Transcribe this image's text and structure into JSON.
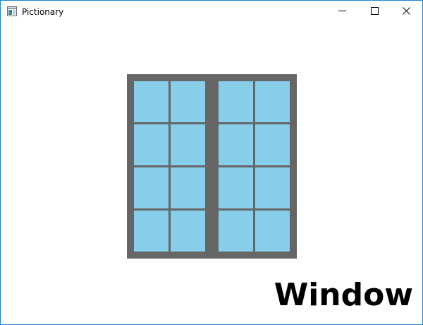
{
  "window": {
    "title": "Pictionary",
    "app_icon": "window-app-icon",
    "controls": {
      "minimize_icon": "minimize-icon",
      "maximize_icon": "maximize-icon",
      "close_icon": "close-icon"
    },
    "accent_color": "#1883d7"
  },
  "drawing": {
    "subject": "window",
    "frame_color": "#666666",
    "glass_color": "#87ceeb",
    "sashes": 2,
    "pane_columns_per_sash": 2,
    "pane_rows": 4
  },
  "word": "Window"
}
